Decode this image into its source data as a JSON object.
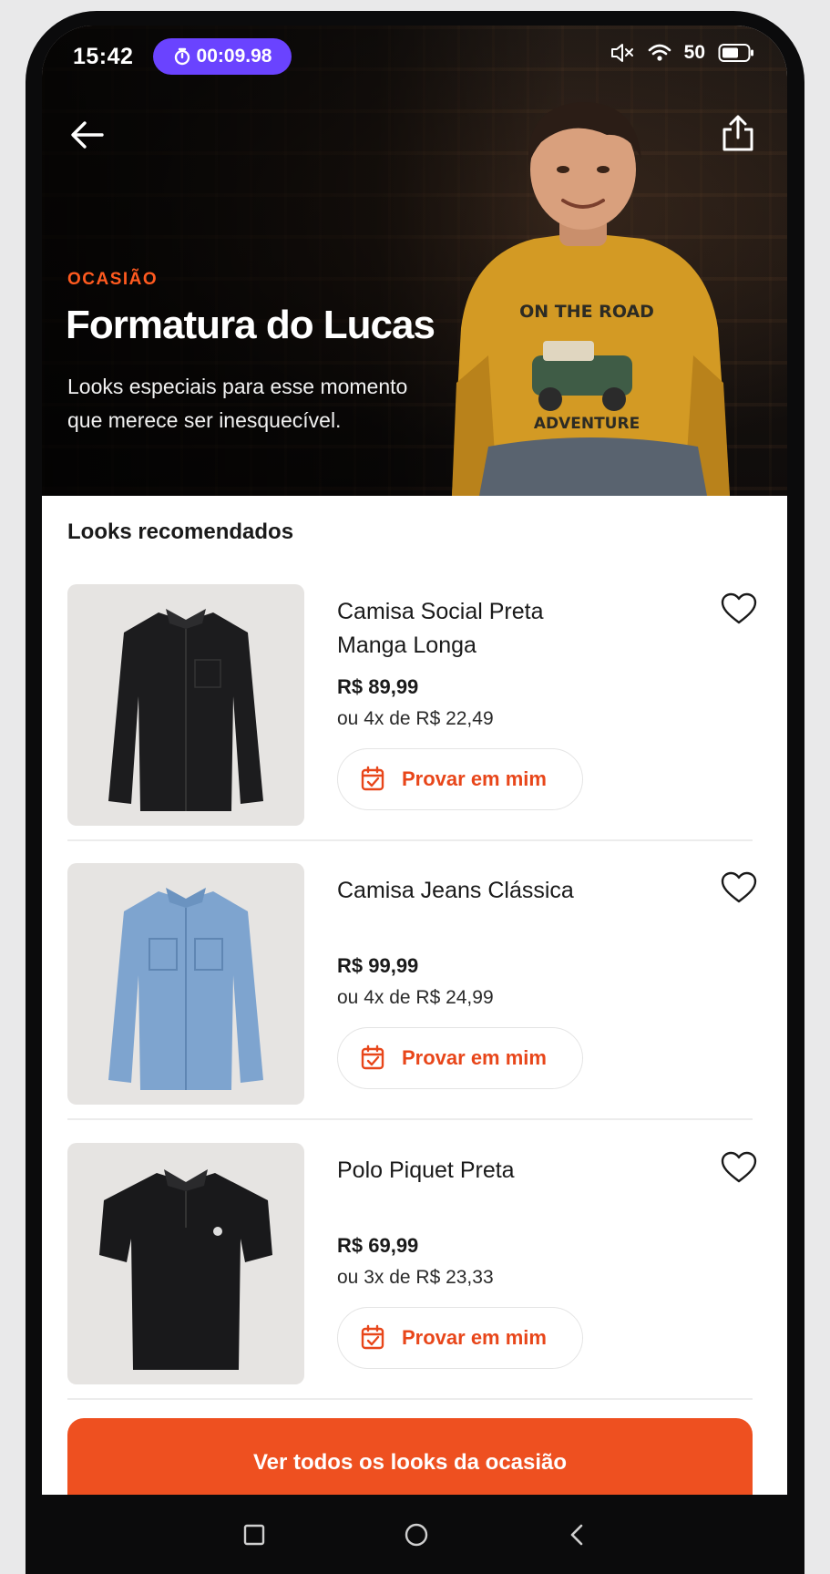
{
  "status": {
    "time": "15:42",
    "timer": "00:09.98",
    "battery": "50"
  },
  "hero": {
    "kicker": "OCASIÃO",
    "title": "Formatura do Lucas",
    "subtitle": "Looks especiais para esse momento que merece ser inesquecível.",
    "shirt_text_top": "ON THE ROAD",
    "shirt_text_bottom": "ADVENTURE"
  },
  "section": {
    "title": "Looks recomendados"
  },
  "products": [
    {
      "name": "Camisa Social Preta Manga Longa",
      "price": "R$ 89,99",
      "installments": "ou 4x de R$ 22,49",
      "button": "Provar em mim"
    },
    {
      "name": "Camisa Jeans Clássica",
      "price": "R$ 99,99",
      "installments": "ou 4x de R$ 24,99",
      "button": "Provar em mim"
    },
    {
      "name": "Polo Piquet Preta",
      "price": "R$ 69,99",
      "installments": "ou 3x de R$ 23,33",
      "button": "Provar em mim"
    }
  ],
  "cta": {
    "label": "Ver todos os looks da ocasião"
  },
  "colors": {
    "accent": "#ee5020",
    "timer": "#6a43ff"
  }
}
